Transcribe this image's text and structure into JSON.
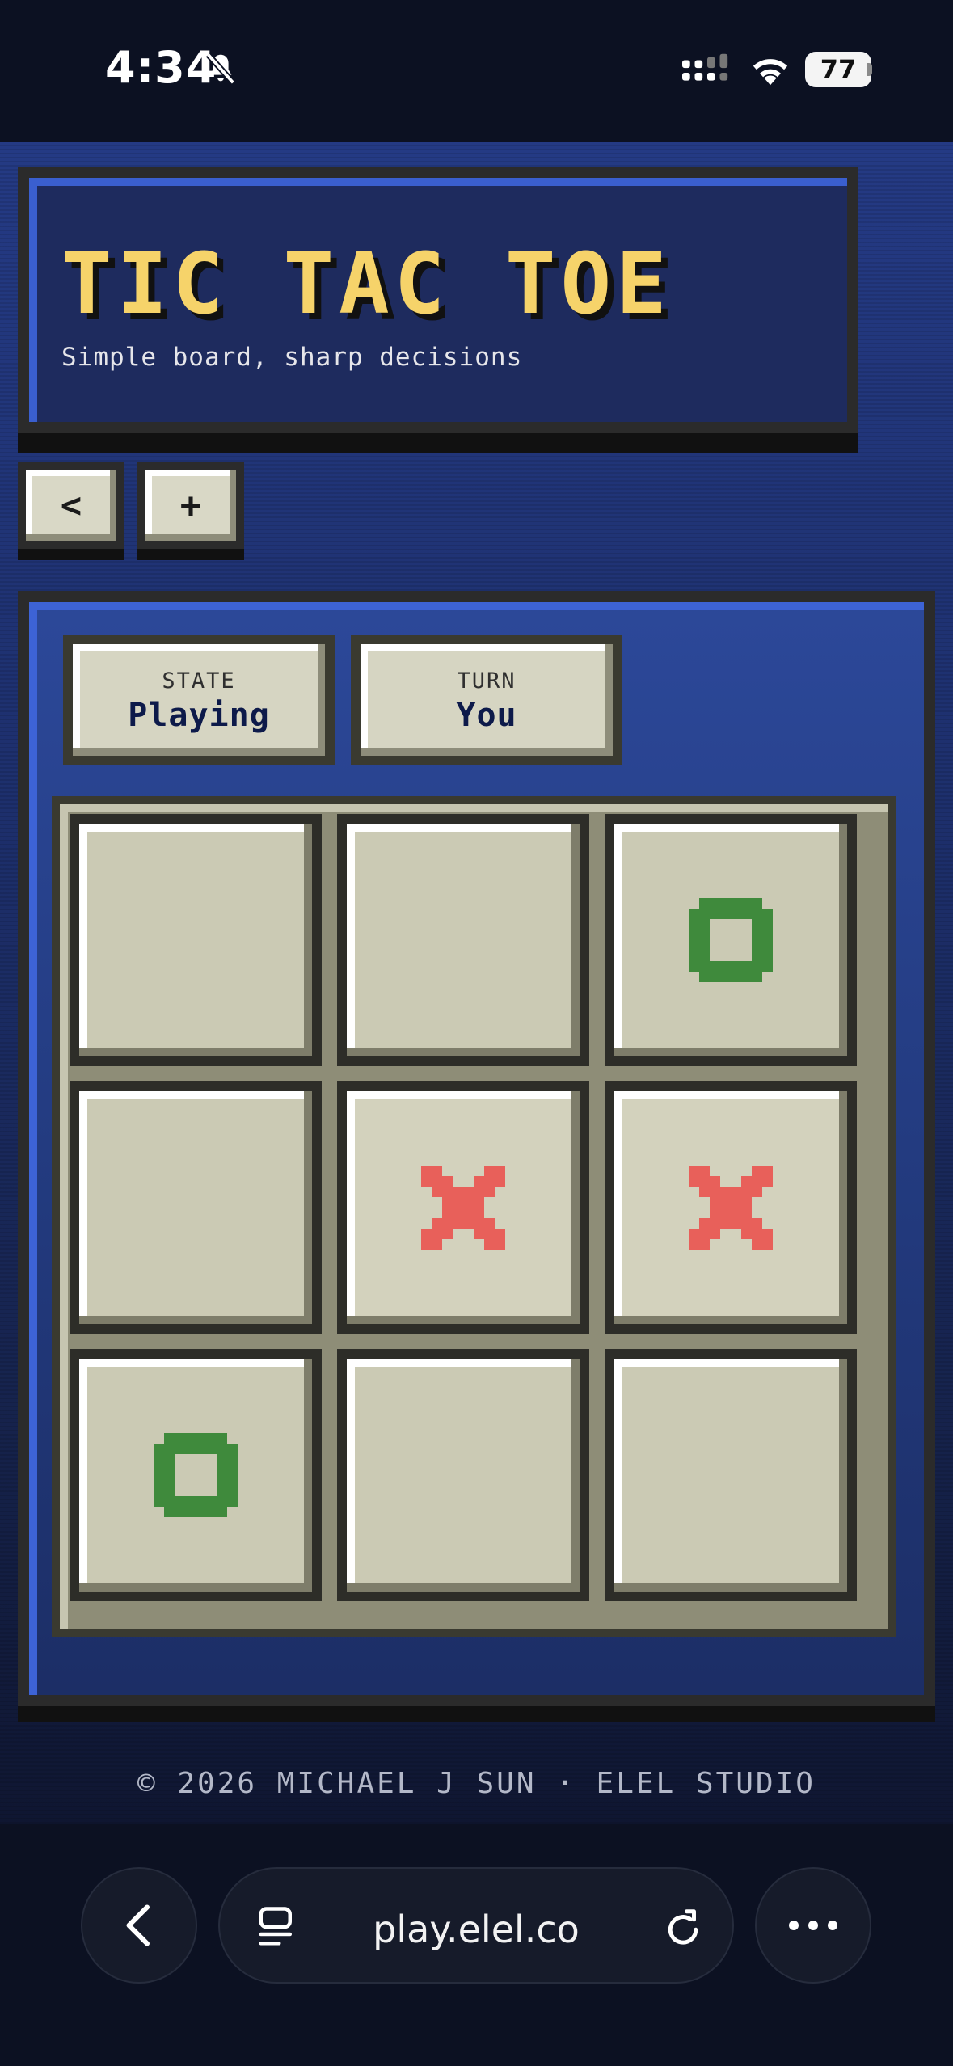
{
  "status_bar": {
    "time": "4:34",
    "battery": "77",
    "icons": [
      "bell-slash-icon",
      "signal-icon",
      "wifi-icon",
      "battery-icon"
    ]
  },
  "header": {
    "title": "TIC TAC TOE",
    "subtitle": "Simple board, sharp decisions"
  },
  "controls": {
    "back_label": "<",
    "new_game_label": "+"
  },
  "info": {
    "state_label": "STATE",
    "state_value": "Playing",
    "turn_label": "TURN",
    "turn_value": "You"
  },
  "board": {
    "cells": [
      "",
      "",
      "O",
      "",
      "X",
      "X",
      "O",
      "",
      ""
    ],
    "colors": {
      "X": "#e8605a",
      "O": "#3f8a3c"
    }
  },
  "footer": {
    "text": "© 2026 MICHAEL J SUN · ELEL STUDIO"
  },
  "browser": {
    "url": "play.elel.co",
    "icons": [
      "back-arrow-icon",
      "tabs-icon",
      "reload-icon",
      "more-icon"
    ]
  },
  "colors": {
    "title_yellow": "#f6d36a",
    "panel_blue": "#233b80",
    "cell_beige": "#cbcab4"
  }
}
